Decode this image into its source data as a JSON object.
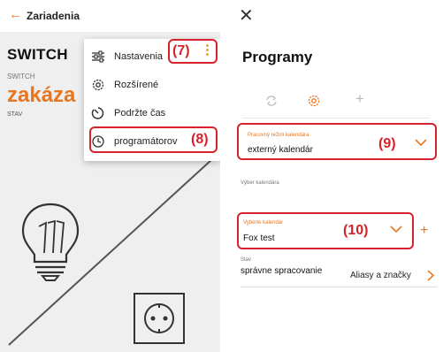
{
  "left": {
    "back_icon": "back-arrow-icon",
    "title": "Zariadenia",
    "device_name": "SWITCH",
    "device_type": "SWITCH",
    "device_state": "zakáza",
    "device_state_label": "STAV",
    "menu": [
      {
        "label": "Nastavenia",
        "icon": "sliders-icon"
      },
      {
        "label": "Rozšírené",
        "icon": "gear-icon"
      },
      {
        "label": "Podržte čas",
        "icon": "timer-icon"
      },
      {
        "label": "programátorov",
        "icon": "clock-icon"
      }
    ],
    "callout_7": "(7)",
    "callout_8": "(8)"
  },
  "right": {
    "close_icon": "close-icon",
    "title": "Programy",
    "tabs": [
      "sync-icon",
      "gear-icon",
      "plus-icon"
    ],
    "calendar_mode": {
      "label": "Pracovný režim kalendára",
      "value": "externý kalendár",
      "callout": "(9)"
    },
    "calendar_select_section": "Výber kalendára",
    "calendar_select": {
      "label": "Vyberte kalendár",
      "value": "Fox test",
      "callout": "(10)"
    },
    "add_symbol": "+",
    "status": {
      "label": "Stav",
      "value": "správne spracovanie"
    },
    "alias_link": "Aliasy a značky"
  },
  "colors": {
    "accent_orange": "#e8761f",
    "highlight_red": "#d6222a",
    "left_bg": "#efefef"
  }
}
